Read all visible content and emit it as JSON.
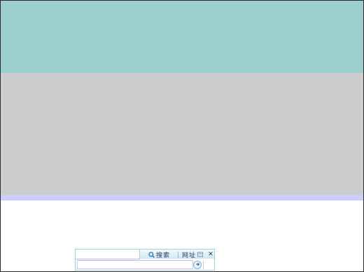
{
  "toolbar": {
    "tab_search_label": "搜索",
    "tab_url_label": "网址",
    "close_symbol": "✕",
    "go_label": "go",
    "input_value": ""
  },
  "colors": {
    "band_top": "#9ccdcf",
    "band_mid": "#cccccc",
    "band_strip": "#ccccff",
    "widget_border": "#9fd0e6"
  },
  "icons": [
    "search-icon",
    "url-icon",
    "close-icon",
    "go-icon"
  ]
}
